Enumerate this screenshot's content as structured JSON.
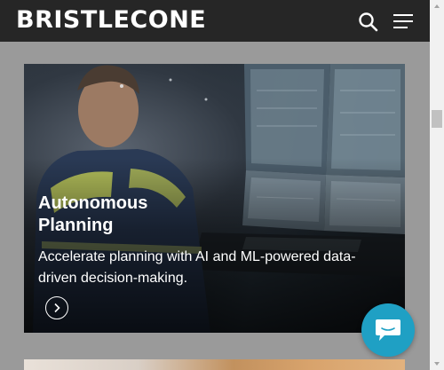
{
  "header": {
    "logo_text": "BRISTLECONE",
    "search_icon": "search-icon",
    "menu_icon": "hamburger-menu-icon"
  },
  "card": {
    "title": "Autonomous Planning",
    "description": "Accelerate planning with AI and ML-powered data-driven decision-making.",
    "arrow_icon": "chevron-right-icon"
  },
  "chat": {
    "icon": "chat-bubble-icon"
  },
  "colors": {
    "header_bg": "#262626",
    "page_bg": "#9a9a9a",
    "chat_accent": "#1fa0c4",
    "text_on_dark": "#ffffff"
  }
}
